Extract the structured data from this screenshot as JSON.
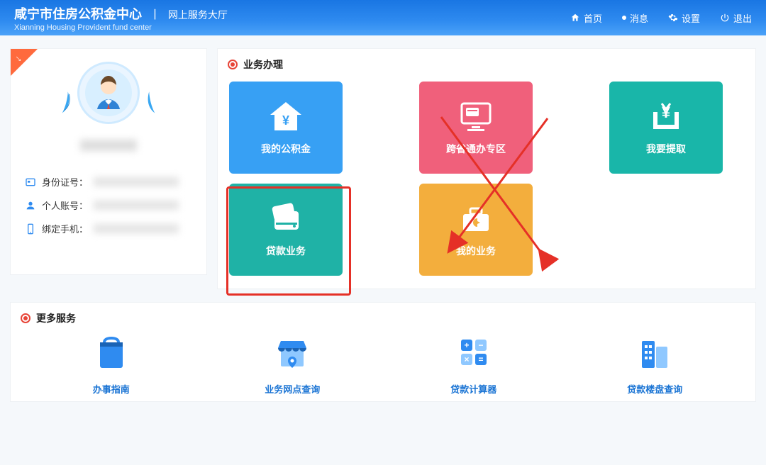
{
  "header": {
    "title_cn": "咸宁市住房公积金中心",
    "title_suffix": "网上服务大厅",
    "title_en": "Xianning Housing Provident fund center",
    "nav": {
      "home": "首页",
      "msg": "消息",
      "settings": "设置",
      "logout": "退出"
    }
  },
  "sidebar": {
    "rows": [
      {
        "icon": "id-icon",
        "label": "身份证号："
      },
      {
        "icon": "person-icon",
        "label": "个人账号："
      },
      {
        "icon": "phone-icon",
        "label": "绑定手机："
      }
    ]
  },
  "main": {
    "section_title": "业务办理",
    "tiles": [
      {
        "key": "fund",
        "label": "我的公积金",
        "color": "blue"
      },
      {
        "key": "cross",
        "label": "跨省通办专区",
        "color": "pink"
      },
      {
        "key": "withdraw",
        "label": "我要提取",
        "color": "teal"
      },
      {
        "key": "loan",
        "label": "贷款业务",
        "color": "teal2"
      },
      {
        "key": "mine",
        "label": "我的业务",
        "color": "amber"
      }
    ]
  },
  "more": {
    "section_title": "更多服务",
    "services": [
      {
        "key": "guide",
        "label": "办事指南"
      },
      {
        "key": "branch",
        "label": "业务网点查询"
      },
      {
        "key": "calc",
        "label": "贷款计算器"
      },
      {
        "key": "estate",
        "label": "贷款楼盘查询"
      }
    ]
  },
  "colors": {
    "highlight": "#e53027",
    "nav_bg": "#2f8bf0"
  }
}
